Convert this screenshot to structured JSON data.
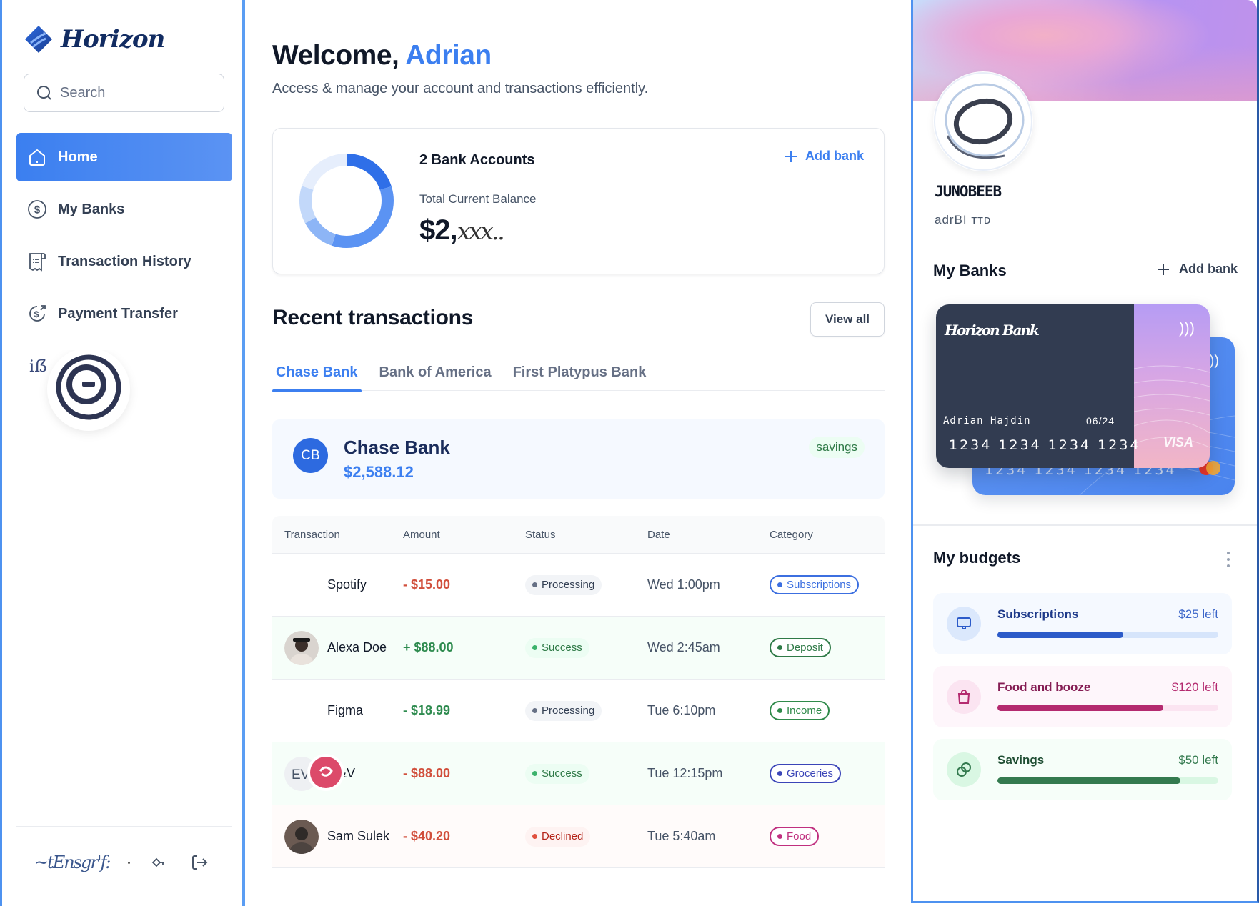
{
  "sidebar": {
    "logo_text": "Horizon",
    "search_placeholder": "Search",
    "nav": [
      {
        "label": "Home",
        "icon": "home-icon",
        "active": true
      },
      {
        "label": "My Banks",
        "icon": "dollar-circle-icon",
        "active": false
      },
      {
        "label": "Transaction History",
        "icon": "receipt-icon",
        "active": false
      },
      {
        "label": "Payment Transfer",
        "icon": "money-send-icon",
        "active": false
      }
    ],
    "footer": {
      "user_label": "~tEnsgr'f:",
      "logout_icon": "logout-icon"
    }
  },
  "header": {
    "welcome_prefix": "Welcome, ",
    "user_name": "Adrian",
    "subtitle": "Access & manage your account and transactions efficiently."
  },
  "balance": {
    "bank_count_label": "2 Bank Accounts",
    "total_label": "Total Current Balance",
    "total_value_visible": "$2,",
    "total_value_obscured": "𝑥𝑥𝑥..",
    "add_bank_label": "Add bank",
    "donut_segments": [
      0.2,
      0.35,
      0.12,
      0.13,
      0.2
    ],
    "donut_colors": [
      "#2f6fe8",
      "#5b93f3",
      "#8db5f6",
      "#c2d8fa",
      "#e6eefc"
    ]
  },
  "transactions": {
    "title": "Recent transactions",
    "view_all_label": "View all",
    "tabs": [
      {
        "label": "Chase Bank",
        "active": true
      },
      {
        "label": "Bank of America",
        "active": false
      },
      {
        "label": "First Platypus Bank",
        "active": false
      }
    ],
    "bank": {
      "initials": "CB",
      "name": "Chase Bank",
      "balance": "$2,588.12",
      "type": "savings"
    },
    "columns": [
      "Transaction",
      "Amount",
      "Status",
      "Date",
      "Category"
    ],
    "rows": [
      {
        "name": "Spotify",
        "avatar": "none",
        "amount": "- $15.00",
        "amount_type": "neg",
        "status": "Processing",
        "status_type": "processing",
        "date": "Wed 1:00pm",
        "category": "Subscriptions",
        "category_color": "#3c6fe0",
        "row_tint": "none"
      },
      {
        "name": "Alexa Doe",
        "avatar": "photo",
        "amount": "+ $88.00",
        "amount_type": "pos",
        "status": "Success",
        "status_type": "success",
        "date": "Wed 2:45am",
        "category": "Deposit",
        "category_color": "#2f7a47",
        "row_tint": "green"
      },
      {
        "name": "Figma",
        "avatar": "none",
        "amount": "- $18.99",
        "amount_type": "pos",
        "status": "Processing",
        "status_type": "processing",
        "date": "Tue 6:10pm",
        "category": "Income",
        "category_color": "#2f8a4a",
        "row_tint": "none"
      },
      {
        "name": "F&V",
        "avatar": "initials-logo",
        "amount": "- $88.00",
        "amount_type": "neg",
        "status": "Success",
        "status_type": "success",
        "date": "Tue 12:15pm",
        "category": "Groceries",
        "category_color": "#3b45b8",
        "row_tint": "green"
      },
      {
        "name": "Sam Sulek",
        "avatar": "photo",
        "amount": "- $40.20",
        "amount_type": "neg",
        "status": "Declined",
        "status_type": "declined",
        "date": "Tue 5:40am",
        "category": "Food",
        "category_color": "#c0307f",
        "row_tint": "red"
      }
    ]
  },
  "right_panel": {
    "profile_name": "JUNOBEEB",
    "profile_email": "adrBI ᴛᴛᴅ",
    "my_banks_title": "My Banks",
    "add_bank_label": "Add bank",
    "cards": {
      "front": {
        "bank_name": "Horizon Bank",
        "holder": "Adrian Hajdin",
        "expiry": "06/24",
        "number": "1234 1234 1234 1234",
        "network": "VISA"
      },
      "back": {
        "number": "1234 1234 1234 1234",
        "network": "mastercard"
      }
    },
    "budgets_title": "My budgets",
    "budgets": [
      {
        "label": "Subscriptions",
        "left": "$25 left",
        "progress": 0.57,
        "icon": "monitor-icon",
        "bg": "#f5f9ff",
        "icon_bg": "#dbe8fc",
        "color": "#2c5bc9",
        "track": "#d6e5fb",
        "text": "#1e3a8a",
        "amt_color": "#3c66c9"
      },
      {
        "label": "Food and booze",
        "left": "$120 left",
        "progress": 0.75,
        "icon": "shopping-bag-icon",
        "bg": "#fef6fb",
        "icon_bg": "#fbe4f1",
        "color": "#b42a6f",
        "track": "#fbe4f1",
        "text": "#851d54",
        "amt_color": "#b42a6f"
      },
      {
        "label": "Savings",
        "left": "$50 left",
        "progress": 0.83,
        "icon": "coins-icon",
        "bg": "#f6fef9",
        "icon_bg": "#d9f7e3",
        "color": "#347a4f",
        "track": "#d9f7e3",
        "text": "#1f4e33",
        "amt_color": "#347a4f"
      }
    ]
  }
}
